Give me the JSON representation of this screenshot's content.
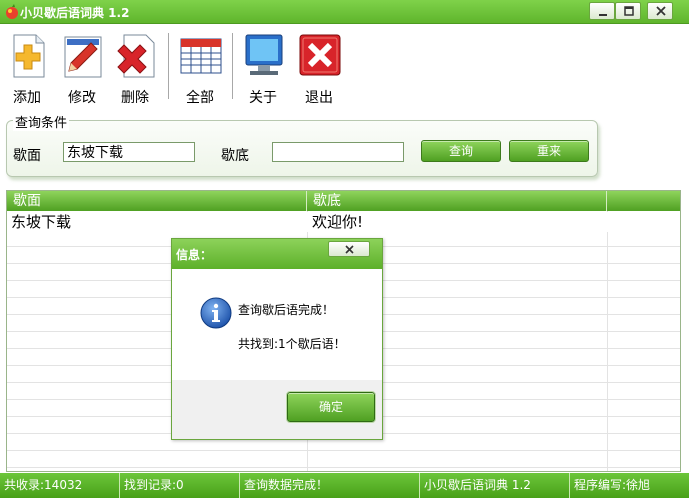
{
  "window": {
    "title": "小贝歇后语词典 1.2"
  },
  "toolbar": {
    "items": [
      {
        "label": "添加",
        "icon": "add-icon"
      },
      {
        "label": "修改",
        "icon": "pencil-icon"
      },
      {
        "label": "删除",
        "icon": "delete-icon"
      },
      {
        "label": "全部",
        "icon": "table-icon"
      },
      {
        "label": "关于",
        "icon": "monitor-icon"
      },
      {
        "label": "退出",
        "icon": "exit-icon"
      }
    ]
  },
  "query": {
    "legend": "查询条件",
    "front_label": "歇面",
    "front_value": "东坡下载",
    "back_label": "歇底",
    "back_value": "",
    "search_button": "查询",
    "reset_button": "重来"
  },
  "grid": {
    "columns": [
      "歇面",
      "歇底"
    ],
    "rows": [
      {
        "front": "东坡下载",
        "back": "欢迎你!"
      }
    ]
  },
  "dialog": {
    "title": "信息：",
    "message1": "查询歇后语完成！",
    "message2": "共找到:1个歇后语！",
    "ok_button": "确定",
    "icon": "info-icon"
  },
  "status": {
    "total": "共收录:14032",
    "found": "找到记录:0",
    "message": "查询数据完成！",
    "app": "小贝歇后语词典 1.2",
    "author": "程序编写:徐旭"
  },
  "colors": {
    "accent_green": "#5fb52c",
    "dark_green": "#3d7a1c"
  }
}
